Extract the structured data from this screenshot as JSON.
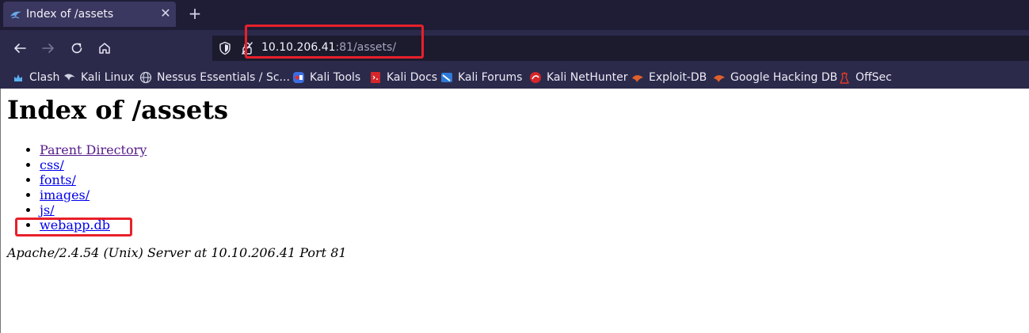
{
  "browser": {
    "tab": {
      "title": "Index of /assets",
      "close": "✕",
      "icon": "kali-dragon-icon"
    },
    "new_tab": "+",
    "nav": {
      "back": "back-arrow-icon",
      "forward": "forward-arrow-icon",
      "reload": "reload-icon",
      "home": "home-icon"
    },
    "url": {
      "host": "10.10.206.41",
      "rest": ":81/assets/"
    },
    "bookmarks": [
      {
        "label": "Clash",
        "icon": "clash-icon",
        "color": "#5ab0f0"
      },
      {
        "label": "Kali Linux",
        "icon": "kali-dragon-icon",
        "color": "#cfd2e0"
      },
      {
        "label": "Nessus Essentials / Sc...",
        "icon": "globe-icon",
        "color": "#cfd2e0"
      },
      {
        "label": "Kali Tools",
        "icon": "kali-tools-icon",
        "color": "#3b6ee0"
      },
      {
        "label": "Kali Docs",
        "icon": "kali-docs-icon",
        "color": "#d6262a"
      },
      {
        "label": "Kali Forums",
        "icon": "kali-forums-icon",
        "color": "#2f7ad8"
      },
      {
        "label": "Kali NetHunter",
        "icon": "kali-nethunter-icon",
        "color": "#d6262a"
      },
      {
        "label": "Exploit-DB",
        "icon": "exploit-db-icon",
        "color": "#e0602a"
      },
      {
        "label": "Google Hacking DB",
        "icon": "ghdb-icon",
        "color": "#e0602a"
      },
      {
        "label": "OffSec",
        "icon": "offsec-icon",
        "color": "#e03a2a"
      }
    ]
  },
  "page": {
    "heading": "Index of /assets",
    "entries": [
      {
        "label": "Parent Directory",
        "visited": true
      },
      {
        "label": "css/",
        "visited": false
      },
      {
        "label": "fonts/",
        "visited": false
      },
      {
        "label": "images/",
        "visited": false
      },
      {
        "label": "js/",
        "visited": false
      },
      {
        "label": "webapp.db",
        "visited": false
      }
    ],
    "footer": "Apache/2.4.54 (Unix) Server at 10.10.206.41 Port 81"
  },
  "colors": {
    "highlight": "#e8202a",
    "link": "#0000ee",
    "visited_link": "#551a8b",
    "chrome_dark": "#1f1d36",
    "chrome": "#2b2a4b"
  }
}
